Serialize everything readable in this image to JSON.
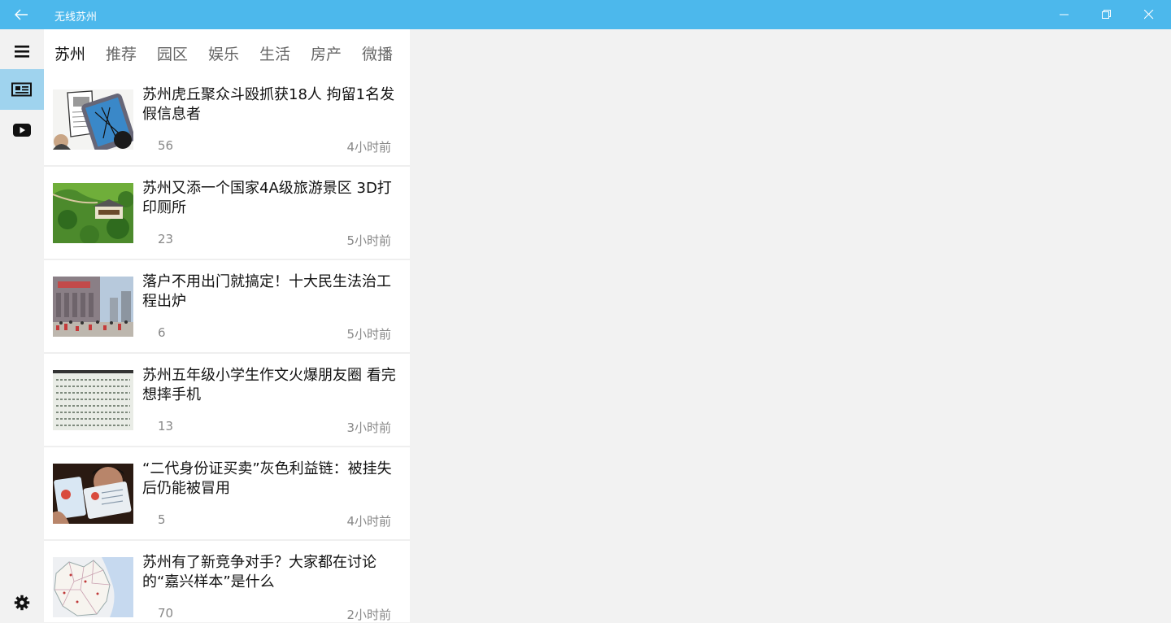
{
  "window": {
    "title": "无线苏州"
  },
  "tabs": [
    "苏州",
    "推荐",
    "园区",
    "娱乐",
    "生活",
    "房产",
    "微播"
  ],
  "articles": [
    {
      "title": "苏州虎丘聚众斗殴抓获18人 拘留1名发假信息者",
      "count": "56",
      "time": "4小时前"
    },
    {
      "title": "苏州又添一个国家4A级旅游景区 3D打印厕所",
      "count": "23",
      "time": "5小时前"
    },
    {
      "title": "落户不用出门就搞定！十大民生法治工程出炉",
      "count": "6",
      "time": "5小时前"
    },
    {
      "title": "苏州五年级小学生作文火爆朋友圈 看完想摔手机",
      "count": "13",
      "time": "3小时前"
    },
    {
      "title": "“二代身份证买卖”灰色利益链：被挂失后仍能被冒用",
      "count": "5",
      "time": "4小时前"
    },
    {
      "title": "苏州有了新竞争对手？大家都在讨论的“嘉兴样本”是什么",
      "count": "70",
      "time": "2小时前"
    }
  ],
  "colors": {
    "accent": "#4cb8ec",
    "rail_selected": "#9fd3ee"
  }
}
